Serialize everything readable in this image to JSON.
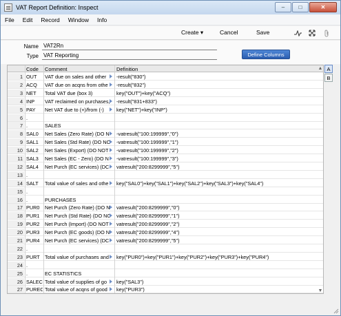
{
  "window": {
    "title": "VAT Report Definition: Inspect",
    "minimize": "–",
    "maximize": "□",
    "close": "✕"
  },
  "menu": [
    "File",
    "Edit",
    "Record",
    "Window",
    "Info"
  ],
  "toolbar": {
    "create": "Create",
    "cancel": "Cancel",
    "save": "Save"
  },
  "header": {
    "name_label": "Name",
    "name_value": "VAT2Rn",
    "type_label": "Type",
    "type_value": "VAT Reporting",
    "define_columns": "Define Columns"
  },
  "grid": {
    "columns": [
      "Code",
      "Comment",
      "Definition"
    ],
    "rows": [
      {
        "n": "1",
        "code": "OUT",
        "comment": "VAT due on sales and other",
        "def": "-result(\"830\")",
        "mark": true
      },
      {
        "n": "2",
        "code": "ACQ",
        "comment": "VAT due on acqns from othe",
        "def": "-result(\"832\")",
        "mark": true
      },
      {
        "n": "3",
        "code": "NET",
        "comment": "Total VAT due (box 3)",
        "def": "key(\"OUT\")+key(\"ACQ\")",
        "mark": false
      },
      {
        "n": "4",
        "code": "INP",
        "comment": "VAT reclaimed on purchases,",
        "def": "-result(\"831+833\")",
        "mark": true
      },
      {
        "n": "5",
        "code": "PAY",
        "comment": "Net VAT due to (+)/from (-)",
        "def": "key(\"NET\")+key(\"INP\")",
        "mark": true
      },
      {
        "n": "6",
        "code": ".",
        "comment": "",
        "def": "",
        "mark": false
      },
      {
        "n": "7",
        "code": ".",
        "comment": "SALES",
        "def": "",
        "mark": false
      },
      {
        "n": "8",
        "code": "SAL0",
        "comment": "Net Sales (Zero Rate)  (DO N",
        "def": "-vatresult(\"100:199999\",\"0\")",
        "mark": true
      },
      {
        "n": "9",
        "code": "SAL1",
        "comment": "Net Sales (Std Rate)  (DO NO",
        "def": "-vatresult(\"100:199999\",\"1\")",
        "mark": true
      },
      {
        "n": "10",
        "code": "SAL2",
        "comment": "Net Sales (Export)  (DO NOT",
        "def": "-vatresult(\"100:199999\",\"2\")",
        "mark": true
      },
      {
        "n": "11",
        "code": "SAL3",
        "comment": "Net Sales (EC - Zero)  (DO N",
        "def": "-vatresult(\"100:199999\",\"3\")",
        "mark": true
      },
      {
        "n": "12",
        "code": "SAL4",
        "comment": "Net Purch (EC services)  (DC",
        "def": "vatresult(\"200:8299999\",\"5\")",
        "mark": true
      },
      {
        "n": "13",
        "code": ".",
        "comment": "",
        "def": "",
        "mark": false
      },
      {
        "n": "14",
        "code": "SALT",
        "comment": "Total value of sales and othe",
        "def": "key(\"SAL0\")+key(\"SAL1\")+key(\"SAL2\")+key(\"SAL3\")+key(\"SAL4\")",
        "mark": true
      },
      {
        "n": "15",
        "code": ".",
        "comment": "",
        "def": "",
        "mark": false
      },
      {
        "n": "16",
        "code": ".",
        "comment": "PURCHASES",
        "def": "",
        "mark": false
      },
      {
        "n": "17",
        "code": "PUR0",
        "comment": "Net Purch (Zero Rate)  (DO N",
        "def": "vatresult(\"200:8299999\",\"0\")",
        "mark": true
      },
      {
        "n": "18",
        "code": "PUR1",
        "comment": "Net Purch (Std Rate)  (DO NO",
        "def": "vatresult(\"200:8299999\",\"1\")",
        "mark": true
      },
      {
        "n": "19",
        "code": "PUR2",
        "comment": "Net Purch (Import)  (DO NOT",
        "def": "vatresult(\"200:8299999\",\"2\")",
        "mark": true
      },
      {
        "n": "20",
        "code": "PUR3",
        "comment": "Net Purch (EC goods)  (DO N",
        "def": "vatresult(\"200:8299999\",\"4\")",
        "mark": true
      },
      {
        "n": "21",
        "code": "PUR4",
        "comment": "Net Purch (EC services)  (DC",
        "def": "vatresult(\"200:8299999\",\"5\")",
        "mark": true
      },
      {
        "n": "22",
        "code": ".",
        "comment": "",
        "def": "",
        "mark": false
      },
      {
        "n": "23",
        "code": "PURT",
        "comment": "Total value of purchases and",
        "def": "key(\"PUR0\")+key(\"PUR1\")+key(\"PUR2\")+key(\"PUR3\")+key(\"PUR4\")",
        "mark": true
      },
      {
        "n": "24",
        "code": ".",
        "comment": "",
        "def": "",
        "mark": false
      },
      {
        "n": "25",
        "code": ".",
        "comment": "EC STATISTICS",
        "def": "",
        "mark": false
      },
      {
        "n": "26",
        "code": "SALEC",
        "comment": "Total value of supplies of go",
        "def": "key(\"SAL3\")",
        "mark": true
      },
      {
        "n": "27",
        "code": "PUREC",
        "comment": "Total value of acqns of good",
        "def": "key(\"PUR3\")",
        "mark": true
      }
    ]
  },
  "side_tabs": [
    "A",
    "B"
  ],
  "icons": {
    "app": "document-icon",
    "sparkline": "activity-icon",
    "expand": "expand-icon",
    "attach": "paperclip-icon"
  }
}
